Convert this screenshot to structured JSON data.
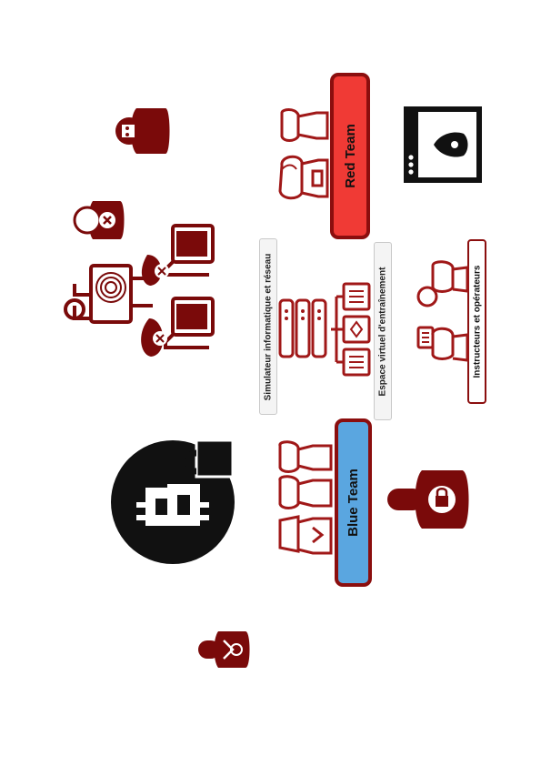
{
  "labels": {
    "red_team": "Red Team",
    "blue_team": "Blue Team",
    "simulator": "Simulateur informatique et réseau",
    "virtual_space": "Espace virtuel d'entraînement",
    "instructors": "Instructeurs et opérateurs"
  },
  "colors": {
    "accent_dark_red": "#7a0a0a",
    "red_team_fill": "#f03a35",
    "blue_team_fill": "#5aa6e0"
  }
}
